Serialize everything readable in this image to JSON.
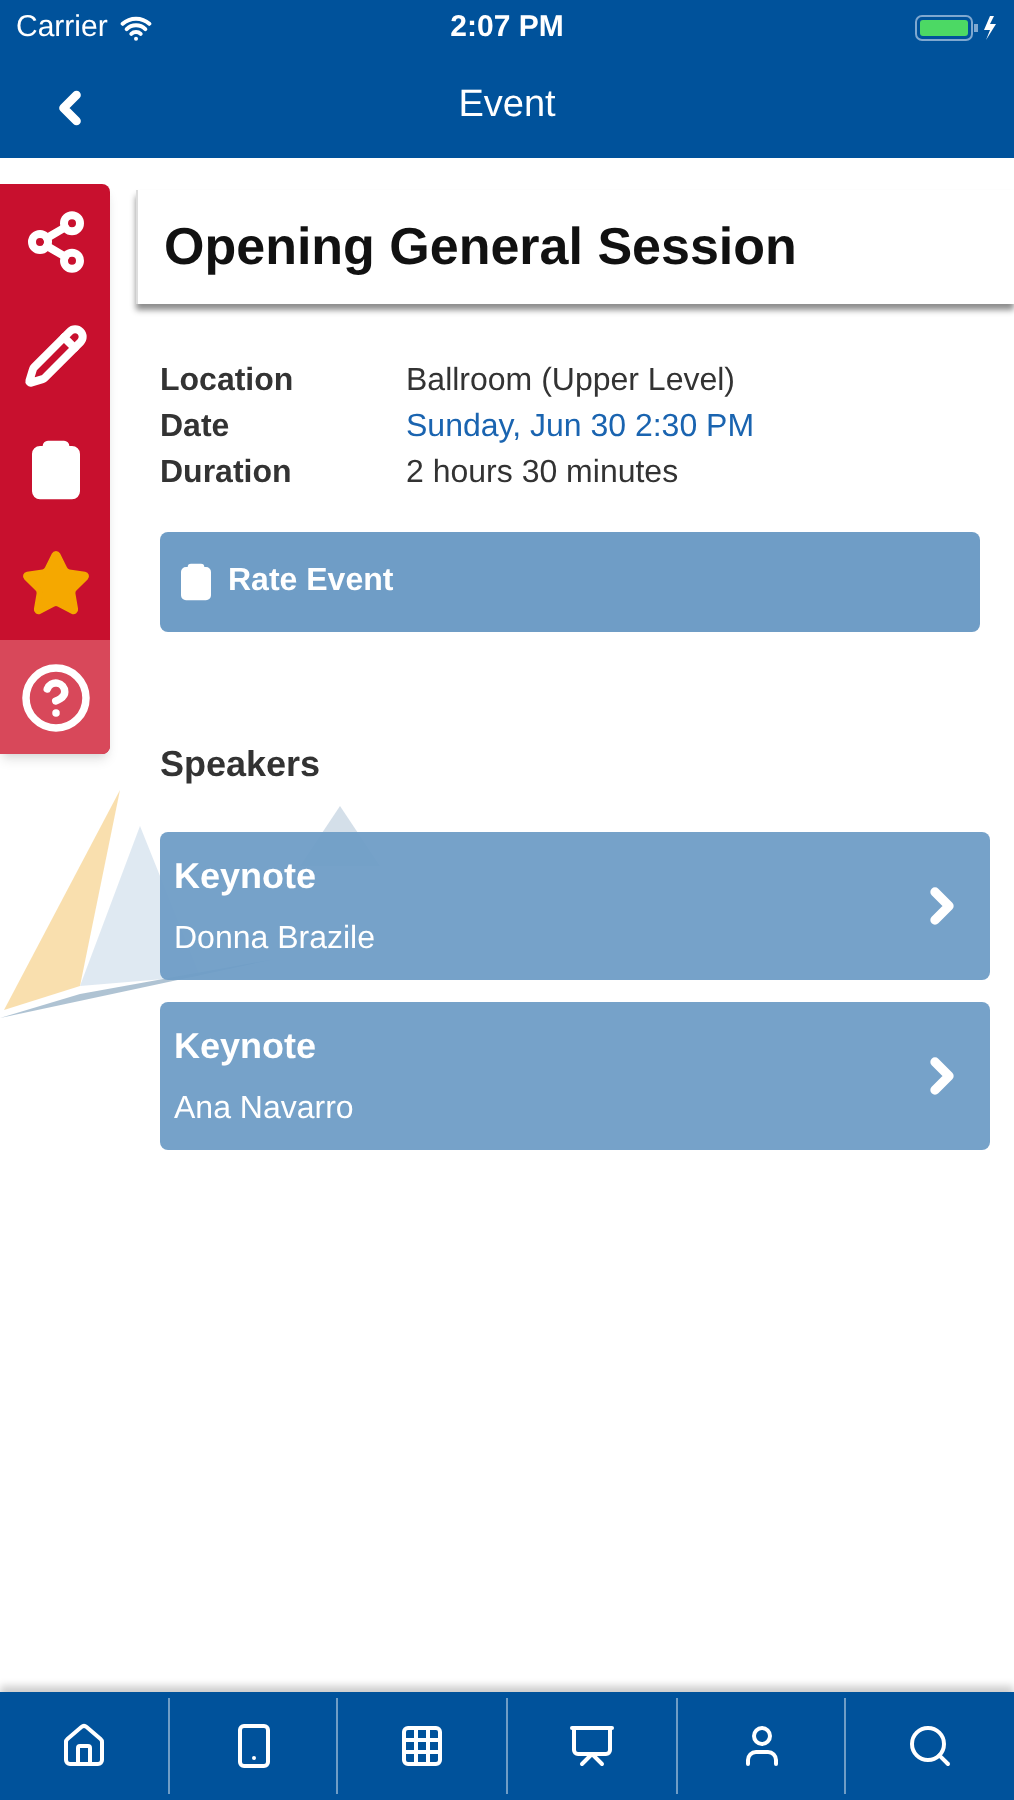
{
  "status_bar": {
    "carrier": "Carrier",
    "time": "2:07 PM"
  },
  "nav": {
    "title": "Event"
  },
  "side_tools": [
    {
      "kind": "share",
      "selected": false
    },
    {
      "kind": "edit",
      "selected": false
    },
    {
      "kind": "clipboard",
      "selected": false
    },
    {
      "kind": "star",
      "selected": false
    },
    {
      "kind": "help",
      "selected": true
    }
  ],
  "event": {
    "title": "Opening General Session",
    "details": [
      {
        "label": "Location",
        "value": "Ballroom (Upper Level)",
        "kind": "text"
      },
      {
        "label": "Date",
        "value": "Sunday, Jun 30 2:30 PM",
        "kind": "link"
      },
      {
        "label": "Duration",
        "value": "2 hours 30 minutes",
        "kind": "text"
      }
    ],
    "rate_button": "Rate Event"
  },
  "speakers": {
    "heading": "Speakers",
    "items": [
      {
        "role": "Keynote",
        "name": "Donna Brazile"
      },
      {
        "role": "Keynote",
        "name": "Ana Navarro"
      }
    ]
  },
  "tab_bar": [
    {
      "kind": "home"
    },
    {
      "kind": "phone"
    },
    {
      "kind": "grid"
    },
    {
      "kind": "easel"
    },
    {
      "kind": "person"
    },
    {
      "kind": "search"
    }
  ]
}
